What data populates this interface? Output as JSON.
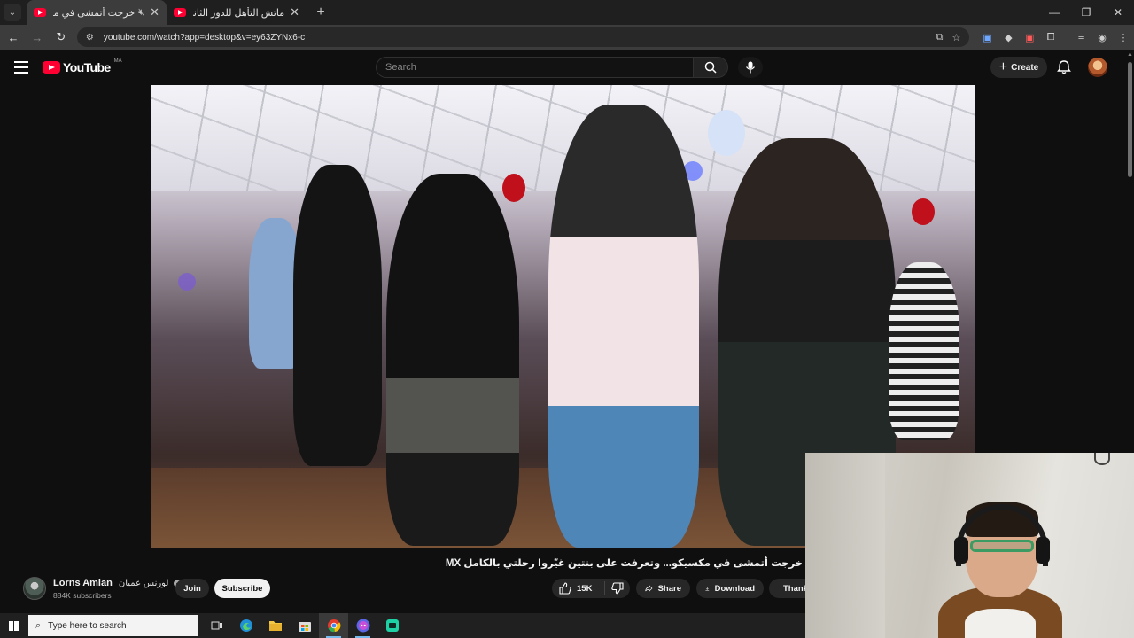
{
  "browser": {
    "tabs": [
      {
        "title": "خرجت أتمشى في مكسيكو...",
        "active": true,
        "muted": true
      },
      {
        "title": "ماتش التأهل للدور الثاني؟ التشكـ",
        "active": false,
        "muted": false
      }
    ],
    "url": "youtube.com/watch?app=desktop&v=ey63ZYNx6-c"
  },
  "youtube": {
    "logo_text": "YouTube",
    "country_code": "MA",
    "search_placeholder": "Search",
    "create_label": "Create"
  },
  "video": {
    "title": "خرجت أتمشى في مكسيكو... وتعرفت على بنتين غيّروا رحلتي بالكامل MX",
    "channel_name": "Lorns Amian",
    "channel_name_ar": "لورنس عميان",
    "subscribers": "884K subscribers",
    "join_label": "Join",
    "subscribe_label": "Subscribe",
    "likes": "15K",
    "share_label": "Share",
    "download_label": "Download",
    "thanks_label": "Thanks"
  },
  "taskbar": {
    "search_placeholder": "Type here to search"
  },
  "colors": {
    "brand_red": "#ff0033",
    "background": "#0f0f0f",
    "chip": "#272727"
  }
}
